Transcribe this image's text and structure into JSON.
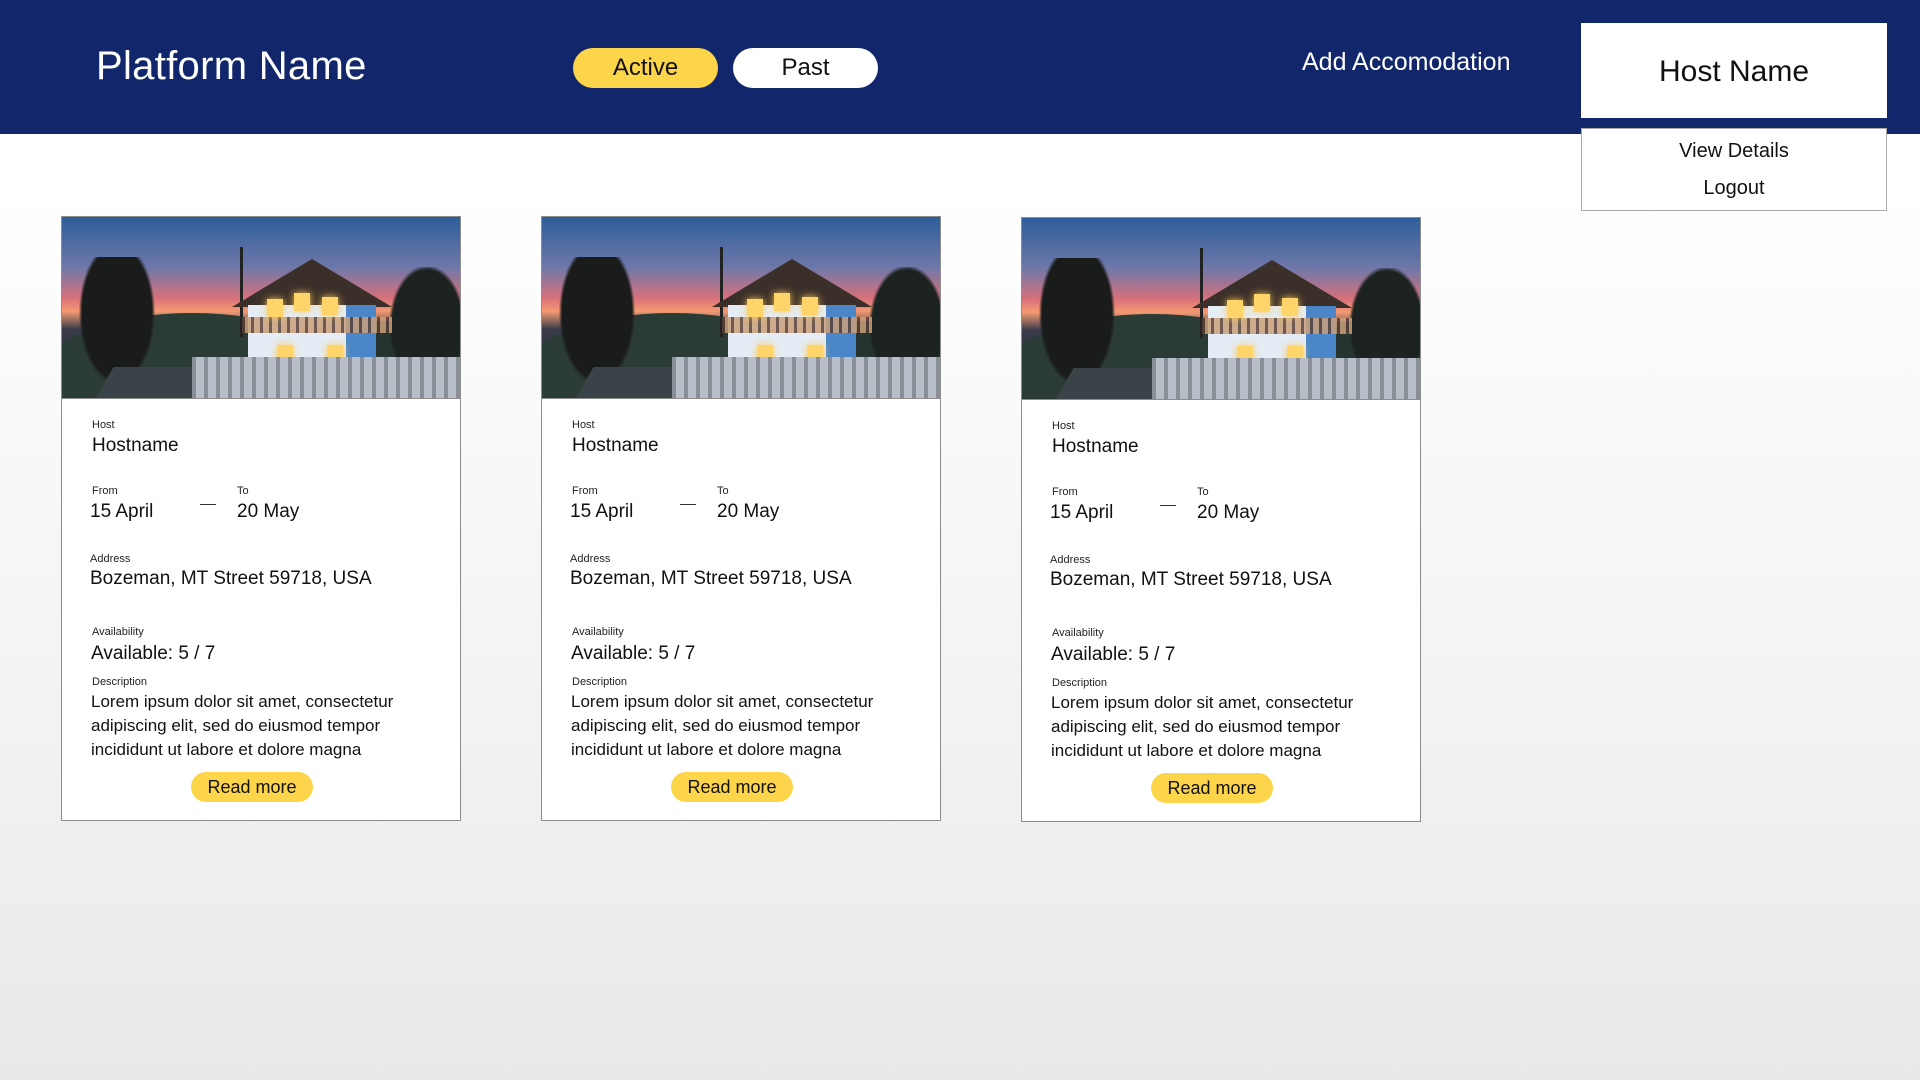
{
  "header": {
    "brand": "Platform Name",
    "tabs": [
      {
        "label": "Active",
        "selected": true
      },
      {
        "label": "Past",
        "selected": false
      }
    ],
    "add_link": "Add Accomodation",
    "host_name": "Host Name",
    "host_menu": [
      "View Details",
      "Logout"
    ]
  },
  "colors": {
    "header_bg": "#12276b",
    "accent": "#fdd54b"
  },
  "listings": [
    {
      "host_label": "Host",
      "host": "Hostname",
      "from_label": "From",
      "from": "15 April",
      "to_label": "To",
      "to": "20 May",
      "address_label": "Address",
      "address": "Bozeman, MT Street 59718, USA",
      "availability_label": "Availability",
      "availability": "Available:  5 / 7",
      "description_label": "Description",
      "description": "Lorem ipsum dolor sit amet, consectetur adipiscing elit, sed do eiusmod tempor incididunt ut labore et dolore magna",
      "read_more": "Read more"
    },
    {
      "host_label": "Host",
      "host": "Hostname",
      "from_label": "From",
      "from": "15 April",
      "to_label": "To",
      "to": "20 May",
      "address_label": "Address",
      "address": "Bozeman, MT Street 59718, USA",
      "availability_label": "Availability",
      "availability": "Available:  5 / 7",
      "description_label": "Description",
      "description": "Lorem ipsum dolor sit amet, consectetur adipiscing elit, sed do eiusmod tempor incididunt ut labore et dolore magna",
      "read_more": "Read more"
    },
    {
      "host_label": "Host",
      "host": "Hostname",
      "from_label": "From",
      "from": "15 April",
      "to_label": "To",
      "to": "20 May",
      "address_label": "Address",
      "address": "Bozeman, MT Street 59718, USA",
      "availability_label": "Availability",
      "availability": "Available:  5 / 7",
      "description_label": "Description",
      "description": "Lorem ipsum dolor sit amet, consectetur adipiscing elit, sed do eiusmod tempor incididunt ut labore et dolore magna",
      "read_more": "Read more"
    }
  ]
}
